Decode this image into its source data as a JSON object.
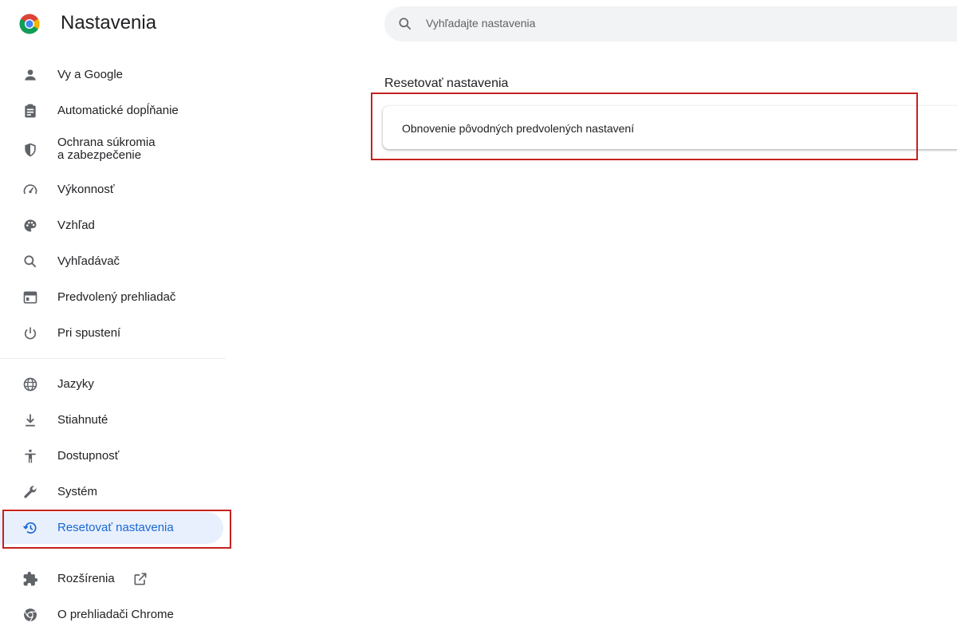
{
  "header": {
    "title": "Nastavenia",
    "search_placeholder": "Vyhľadajte nastavenia"
  },
  "sidebar": {
    "items": [
      {
        "label": "Vy a Google",
        "icon": "person-icon"
      },
      {
        "label": "Automatické dopĺňanie",
        "icon": "clipboard-icon"
      },
      {
        "label_line1": "Ochrana súkromia",
        "label_line2": "a zabezpečenie",
        "icon": "shield-icon"
      },
      {
        "label": "Výkonnosť",
        "icon": "speedometer-icon"
      },
      {
        "label": "Vzhľad",
        "icon": "palette-icon"
      },
      {
        "label": "Vyhľadávač",
        "icon": "search-icon"
      },
      {
        "label": "Predvolený prehliadač",
        "icon": "browser-window-icon"
      },
      {
        "label": "Pri spustení",
        "icon": "power-icon"
      },
      {
        "label": "Jazyky",
        "icon": "globe-icon"
      },
      {
        "label": "Stiahnuté",
        "icon": "download-icon"
      },
      {
        "label": "Dostupnosť",
        "icon": "accessibility-icon"
      },
      {
        "label": "Systém",
        "icon": "wrench-icon"
      },
      {
        "label": "Resetovať nastavenia",
        "icon": "restore-icon",
        "active": true
      },
      {
        "label": "Rozšírenia",
        "icon": "puzzle-icon"
      },
      {
        "label": "O prehliadači Chrome",
        "icon": "chrome-icon"
      }
    ]
  },
  "main": {
    "section_title": "Resetovať nastavenia",
    "card_label": "Obnovenie pôvodných predvolených nastavení"
  },
  "colors": {
    "accent": "#1967d2",
    "active_bg": "#e8f0fe",
    "highlight_border": "#c5221f",
    "icon": "#5f6368"
  }
}
